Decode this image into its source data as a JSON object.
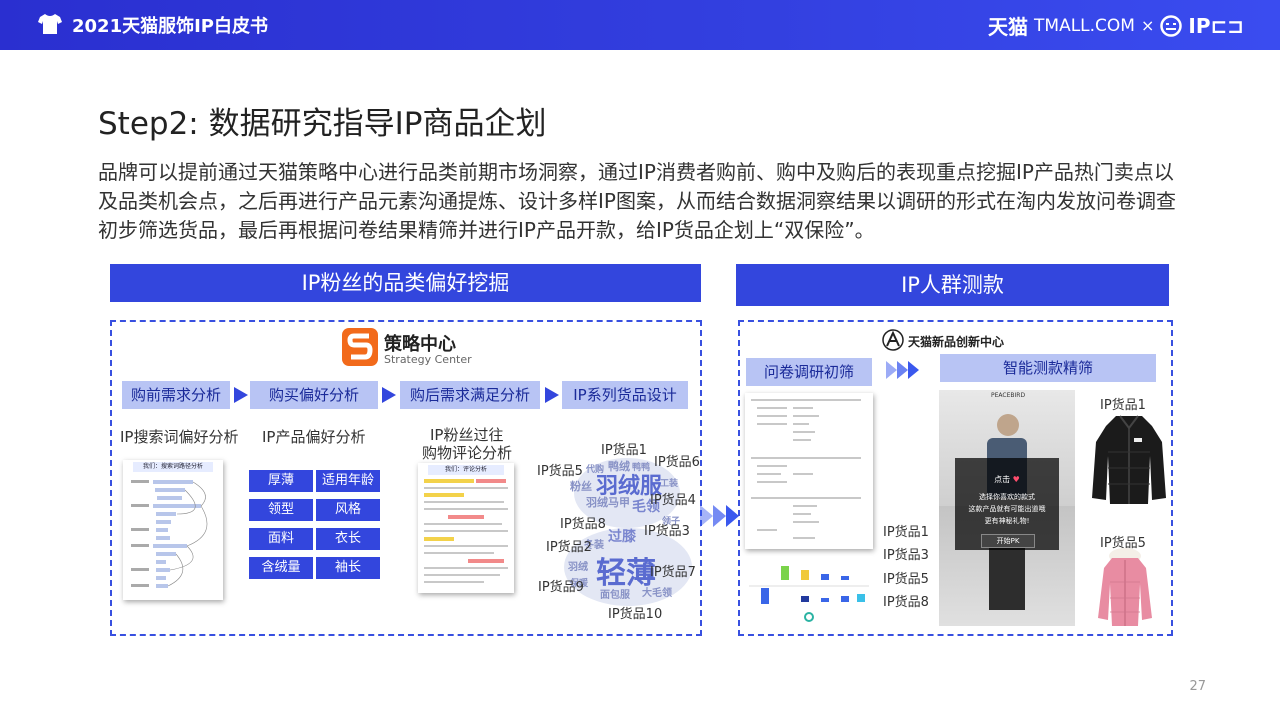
{
  "header": {
    "title": "2021天猫服饰IP白皮书",
    "brand_cn": "天猫",
    "brand_tm": "TMALL.COM",
    "times": "×",
    "brand_ip": "IP⊏⊐",
    "colors": {
      "primary": "#3346dd"
    }
  },
  "title": "Step2: 数据研究指导IP商品企划",
  "paragraph": "品牌可以提前通过天猫策略中心进行品类前期市场洞察，通过IP消费者购前、购中及购后的表现重点挖掘IP产品热门卖点以及品类机会点，之后再进行产品元素沟通提炼、设计多样IP图案，从而结合数据洞察结果以调研的形式在淘内发放问卷调查初步筛选货品，最后再根据问卷结果精筛并进行IP产品开款，给IP货品企划上“双保险”。",
  "left": {
    "bar": "IP粉丝的品类偏好挖掘",
    "logo_cn": "策略中心",
    "logo_en": "Strategy Center",
    "steps": [
      "购前需求分析",
      "购买偏好分析",
      "购后需求满足分析",
      "IP系列货品设计"
    ],
    "sub1": "IP搜索词偏好分析",
    "sub2": "IP产品偏好分析",
    "sub3a": "IP粉丝过往",
    "sub3b": "购物评论分析",
    "tags": [
      "厚薄",
      "适用年龄",
      "领型",
      "风格",
      "面料",
      "衣长",
      "含绒量",
      "袖长"
    ],
    "doc1_title": "我们：搜索词路径分析",
    "doc2_title": "我们：评论分析",
    "goods": [
      "IP货品1",
      "IP货品6",
      "IP货品5",
      "IP货品4",
      "IP货品8",
      "IP货品3",
      "IP货品2",
      "IP货品7",
      "IP货品9",
      "IP货品10"
    ],
    "words": [
      "羽绒服",
      "轻薄",
      "过膝",
      "鸭绒",
      "毛领",
      "羽绒马甲",
      "粉丝",
      "代购",
      "工装",
      "冬装",
      "大毛领",
      "面包服",
      "鸭鸭",
      "羽绒",
      "领子",
      "保暖"
    ]
  },
  "right": {
    "bar": "IP人群测款",
    "logo": "天猫新品创新中心",
    "survey": "问卷调研初筛",
    "smart": "智能测款精筛",
    "goods_list": [
      "IP货品1",
      "IP货品3",
      "IP货品5",
      "IP货品8"
    ],
    "goods_top": "IP货品1",
    "goods_bottom": "IP货品5",
    "phone_brand": "PEACEBIRD",
    "popup_click": "点击",
    "popup_l1": "选择你喜欢的款式",
    "popup_l2": "这款产品就有可能出道哦",
    "popup_l3": "更有神秘礼物!",
    "popup_btn": "开始PK"
  },
  "page_number": "27"
}
